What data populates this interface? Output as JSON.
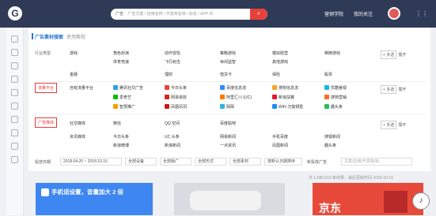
{
  "header": {
    "search_select": "广告",
    "search_placeholder": "广告文案 / 应用名称 / 开发商名称 / 标名 / APP ID",
    "nav": [
      "营销学院",
      "我的关注"
    ]
  },
  "panel": {
    "title": "广告素材搜索",
    "subtitle": "使用教程",
    "industry_label": "行业类型",
    "traffic_label": "流量平台",
    "media_label": "广告媒体",
    "industry": [
      [
        "游戏",
        "角色扮演",
        "动作冒险",
        "策略游戏",
        "模拟经营",
        "棋牌游戏"
      ],
      [
        "",
        "体育竞速",
        "飞行射击",
        "休闲益智",
        "其他游戏",
        ""
      ],
      [
        "金融",
        "",
        "理财",
        "借贷卡",
        "保险",
        "股票"
      ]
    ],
    "traffic": [
      [
        "自有流量平台",
        "腾讯社交广告",
        "今日头条",
        "百度信息流",
        "搜狗信息流",
        "优酷睿视"
      ],
      [
        "",
        "爱奇艺",
        "网易易效",
        "阿里汇川 (UC)",
        "新浪扶翼",
        "搜狗营销"
      ],
      [
        "",
        "",
        "智慧推广",
        "凤凰凤羽",
        "陌陌",
        "WiFi 万能钥匙",
        "趣头条"
      ]
    ],
    "media": [
      [
        "社交媒体",
        "微信",
        "QQ 空间",
        "百度贴吧",
        "",
        ""
      ],
      [
        "资讯媒体",
        "今日头条",
        "UC 头条",
        "网易新闻",
        "手机百度",
        "搜狐新闻"
      ],
      [
        "",
        "新浪微博",
        "新浪新闻",
        "一点资讯",
        "凤凰新闻",
        "趣头条"
      ]
    ],
    "more_select": "+ 多选",
    "expand": "展开"
  },
  "filter": {
    "date_label": "投放日期",
    "date_range": "2018.04.20 ~ 2018.10.16",
    "options": [
      "全部设备",
      "全部版广",
      "全部形式",
      "全部素材",
      "按新认日期排序"
    ],
    "new_ad_label": "新投放广告",
    "copy_search_placeholder": "文案/应用/开发商/标...",
    "results": "共 1,680,610 条结果，最后更新时间 2018-10-16"
  },
  "cards": [
    {
      "text": "手机话设置，音量加大 2 倍"
    },
    {
      "text": ""
    },
    {
      "text": "京东"
    }
  ],
  "colors": {
    "topbar": "#2f3a57",
    "accent": "#2a77d6",
    "highlight": "#e23b3b"
  }
}
